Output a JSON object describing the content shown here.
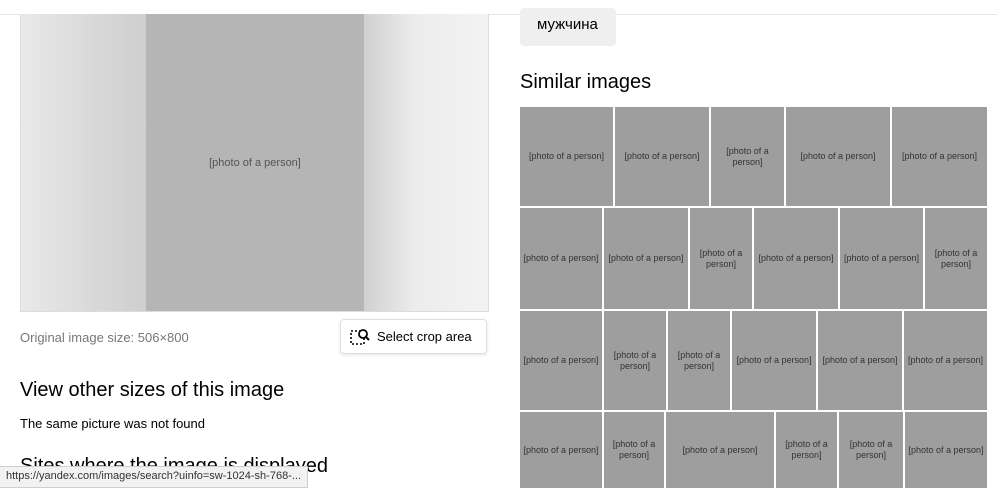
{
  "status_url": "https://yandex.com/images/search?uinfo=sw-1024-sh-768-...",
  "preview": {
    "placeholder": "[photo of a person]"
  },
  "original_size": "Original image size: 506×800",
  "crop_button": "Select crop area",
  "sizes_heading": "View other sizes of this image",
  "not_found": "The same picture was not found",
  "sites_heading": "Sites where the image is displayed",
  "tag": "мужчина",
  "similar_heading": "Similar images",
  "similar": {
    "placeholder": "[photo of a person]"
  }
}
